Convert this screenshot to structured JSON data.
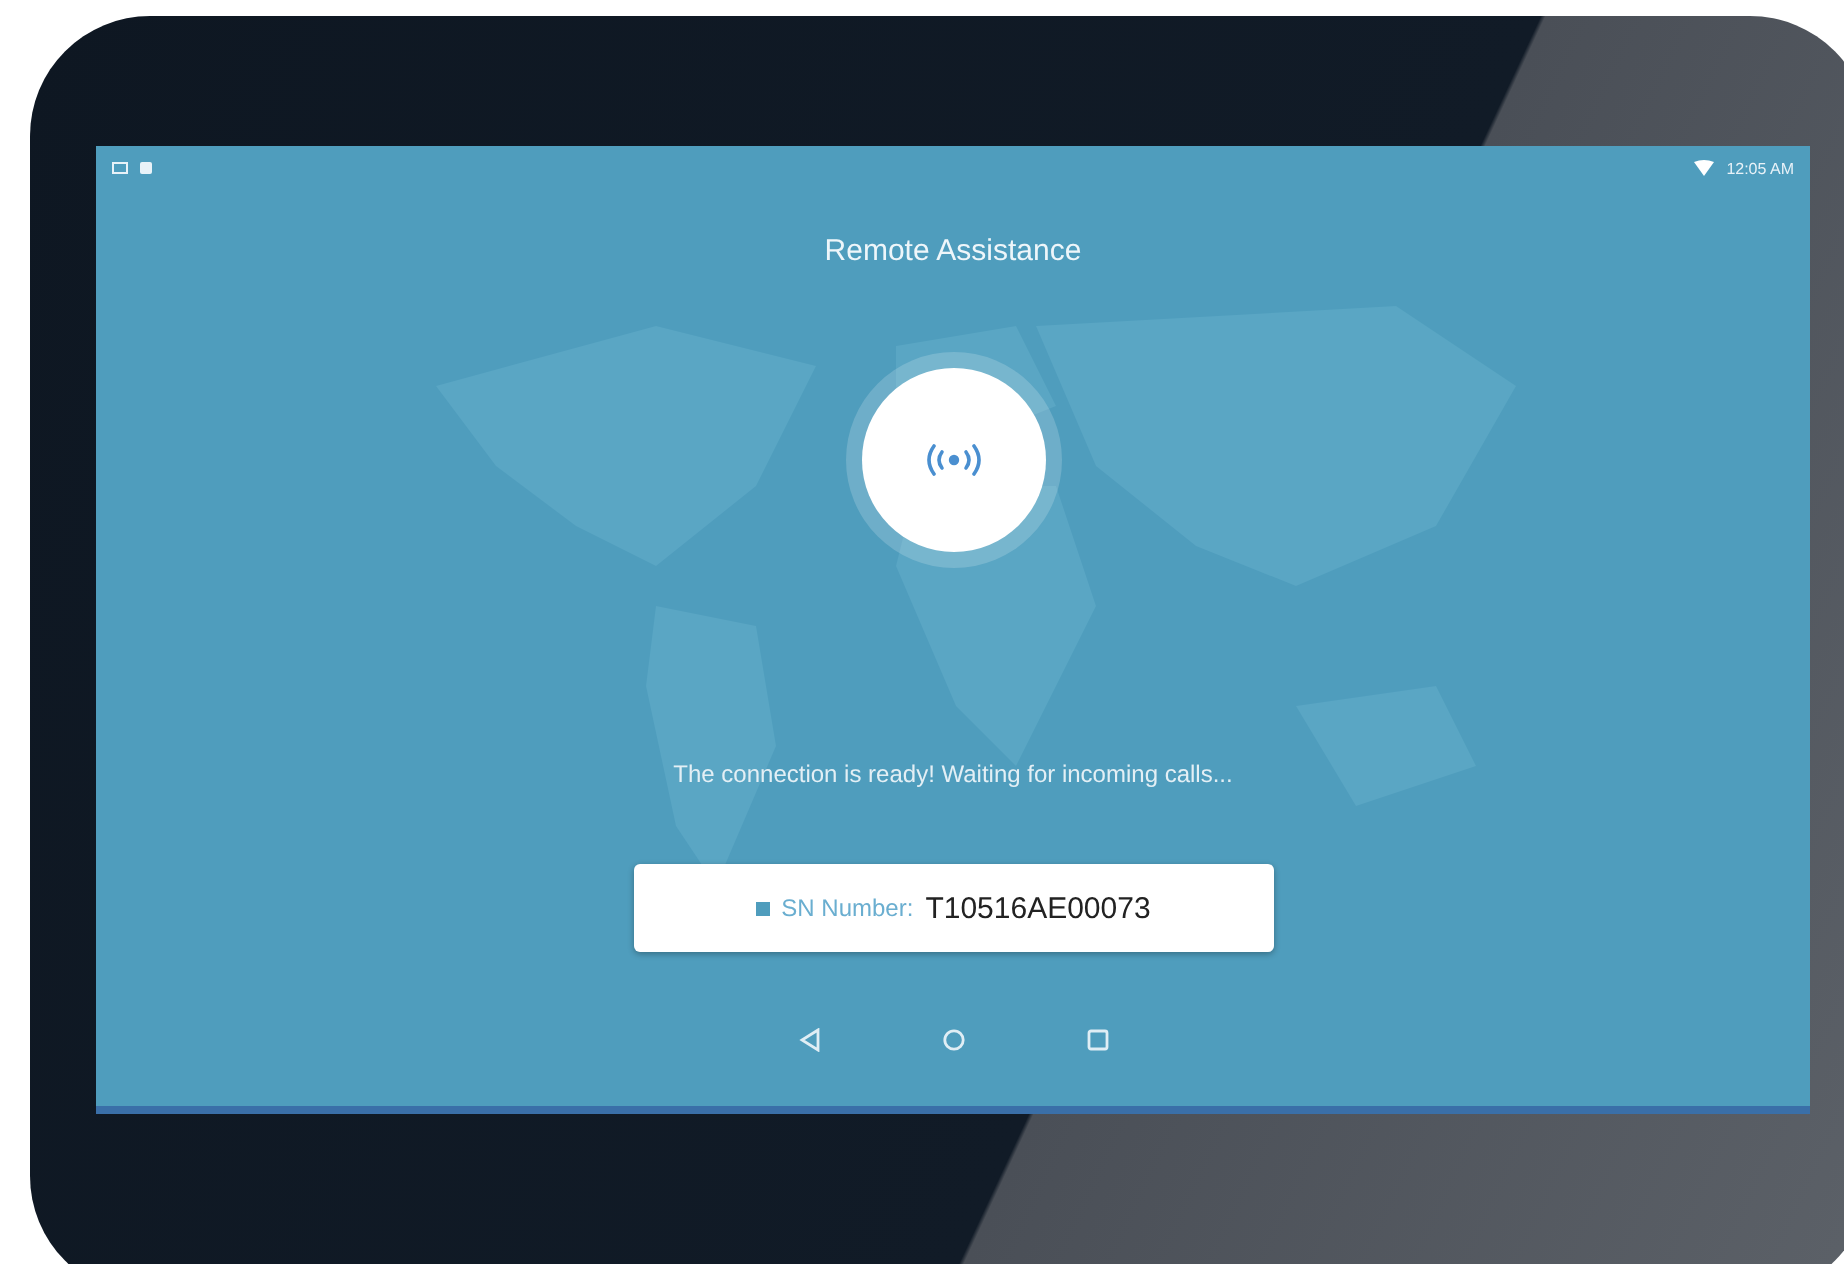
{
  "status_bar": {
    "time": "12:05 AM"
  },
  "title": "Remote Assistance",
  "status_message": "The connection is ready! Waiting for incoming calls...",
  "serial": {
    "label": "SN Number:",
    "value": "T10516AE00073"
  }
}
